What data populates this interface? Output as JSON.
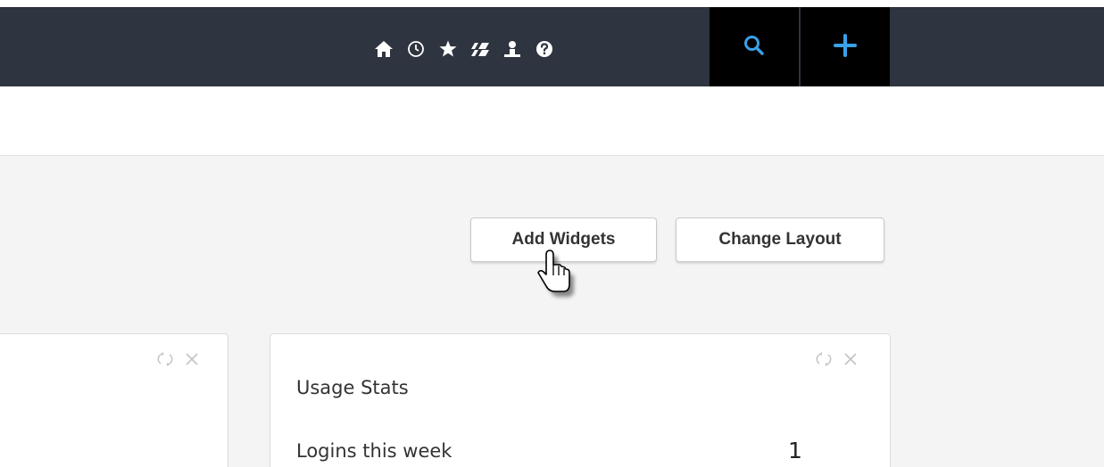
{
  "nav": {
    "icons": [
      "home-icon",
      "clock-icon",
      "star-icon",
      "apps-icon",
      "user-icon",
      "help-icon"
    ],
    "search_icon": "search-icon",
    "add_icon": "plus-icon",
    "accent_color": "#3aa0e8"
  },
  "toolbar": {
    "add_widgets_label": "Add Widgets",
    "change_layout_label": "Change Layout"
  },
  "widgets": [
    {
      "title": "",
      "controls": [
        "refresh-icon",
        "close-icon"
      ]
    },
    {
      "title": "Usage Stats",
      "controls": [
        "refresh-icon",
        "close-icon"
      ],
      "stats": [
        {
          "label": "Logins this week",
          "value": "1"
        }
      ]
    }
  ],
  "colors": {
    "topbar": "#2e3440",
    "action_bg": "#000000",
    "content_bg": "#f4f4f4"
  }
}
